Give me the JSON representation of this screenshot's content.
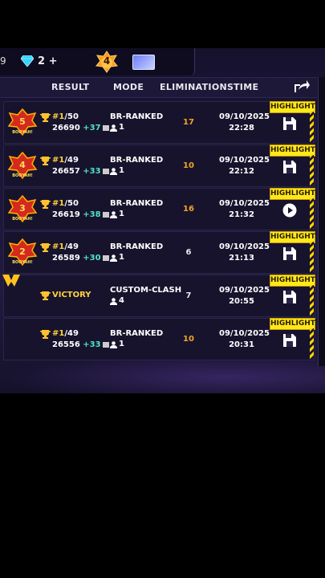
{
  "topbar": {
    "partial_number": "9",
    "gems": "2 +",
    "level": "4"
  },
  "header": {
    "result": "RESULT",
    "mode": "MODE",
    "eliminations": "ELIMINATIONS",
    "time": "TIME"
  },
  "colors": {
    "accent_yellow": "#ffe81a",
    "gain_teal": "#4fe3c8",
    "elims_orange": "#f2a623"
  },
  "rows": [
    {
      "badge": "5",
      "badge_text": "BOOYAH!",
      "place": "#1",
      "total": "/50",
      "score": "26690",
      "delta": "+37",
      "mode": "BR-RANKED",
      "players": "1",
      "eliminations": "17",
      "date": "09/10/2025",
      "time": "22:28",
      "highlight": "HIGHLIGHT",
      "action_icon": "save-icon"
    },
    {
      "badge": "4",
      "badge_text": "BOOYAH!",
      "place": "#1",
      "total": "/49",
      "score": "26657",
      "delta": "+33",
      "mode": "BR-RANKED",
      "players": "1",
      "eliminations": "10",
      "date": "09/10/2025",
      "time": "22:12",
      "highlight": "HIGHLIGHT",
      "action_icon": "save-icon"
    },
    {
      "badge": "3",
      "badge_text": "BOOYAH!",
      "place": "#1",
      "total": "/50",
      "score": "26619",
      "delta": "+38",
      "mode": "BR-RANKED",
      "players": "1",
      "eliminations": "16",
      "date": "09/10/2025",
      "time": "21:32",
      "highlight": "HIGHLIGHT",
      "action_icon": "play-icon"
    },
    {
      "badge": "2",
      "badge_text": "BOOYAH!",
      "place": "#1",
      "total": "/49",
      "score": "26589",
      "delta": "+30",
      "mode": "BR-RANKED",
      "players": "1",
      "eliminations": "6",
      "date": "09/10/2025",
      "time": "21:13",
      "highlight": "HIGHLIGHT",
      "action_icon": "save-icon"
    },
    {
      "result": "VICTORY",
      "mode": "CUSTOM-CLASH",
      "players": "4",
      "eliminations": "7",
      "date": "09/10/2025",
      "time": "20:55",
      "highlight": "HIGHLIGHT",
      "action_icon": "save-icon"
    },
    {
      "place": "#1",
      "total": "/49",
      "score": "26556",
      "delta": "+33",
      "mode": "BR-RANKED",
      "players": "1",
      "eliminations": "10",
      "date": "09/10/2025",
      "time": "20:31",
      "highlight": "HIGHLIGHT",
      "action_icon": "save-icon"
    }
  ]
}
